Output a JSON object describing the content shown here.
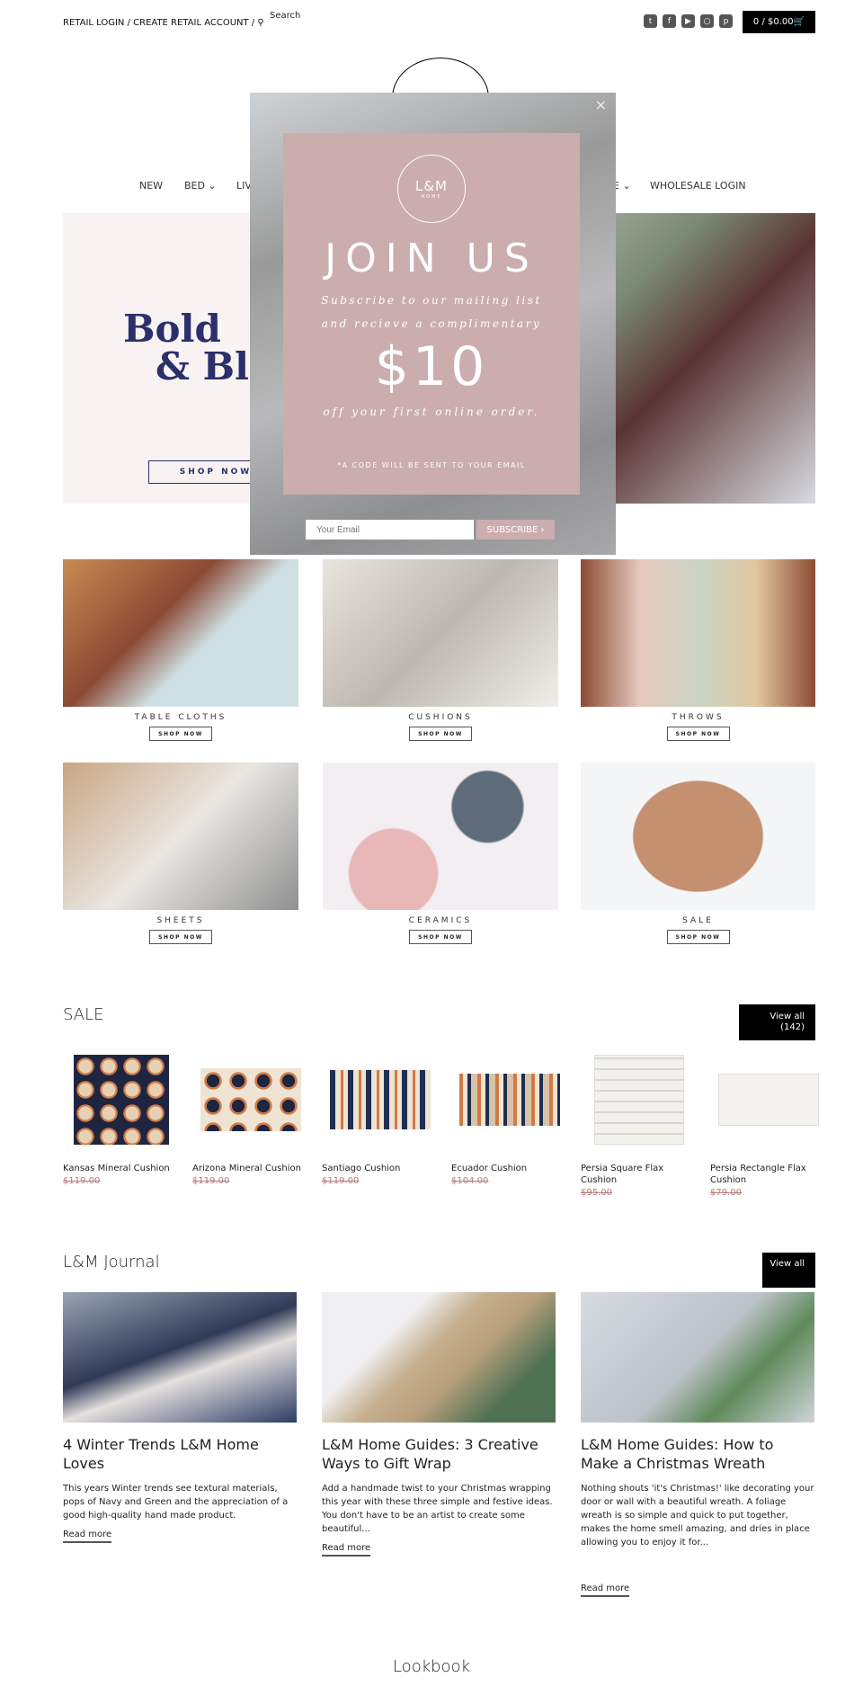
{
  "header": {
    "retail_login": "RETAIL LOGIN",
    "create_account": " / CREATE RETAIL ACCOUNT",
    "sep": " / ",
    "search": "Search",
    "cart": "0 / $0.00",
    "social": [
      "twitter-icon",
      "facebook-icon",
      "youtube-icon",
      "instagram-icon",
      "pinterest-icon"
    ]
  },
  "nav": {
    "items": [
      "NEW",
      "BED",
      "LIV",
      "E",
      "WHOLESALE LOGIN"
    ]
  },
  "hero": {
    "line1": "Bold",
    "line2": "& Bl",
    "button": "SHOP NOW",
    "color": "#2b2f6b"
  },
  "categories": [
    {
      "label": "TABLE CLOTHS",
      "button": "SHOP NOW"
    },
    {
      "label": "CUSHIONS",
      "button": "SHOP NOW"
    },
    {
      "label": "THROWS",
      "button": "SHOP NOW"
    },
    {
      "label": "SHEETS",
      "button": "SHOP NOW"
    },
    {
      "label": "CERAMICS",
      "button": "SHOP NOW"
    },
    {
      "label": "SALE",
      "button": "SHOP NOW"
    }
  ],
  "sale": {
    "title": "SALE",
    "view_all": "View all",
    "count": "(142)",
    "products": [
      {
        "name": "Kansas Mineral Cushion",
        "price": "$119.00"
      },
      {
        "name": "Arizona Mineral Cushion",
        "price": "$119.00"
      },
      {
        "name": "Santiago Cushion",
        "price": "$119.00"
      },
      {
        "name": "Ecuador Cushion",
        "price": "$104.00"
      },
      {
        "name": "Persia Square Flax Cushion",
        "price": "$95.00"
      },
      {
        "name": "Persia Rectangle Flax Cushion",
        "price": "$79.00"
      }
    ]
  },
  "journal": {
    "title": "L&M Journal",
    "view_all": "View all",
    "posts": [
      {
        "title": "4 Winter Trends L&M Home Loves",
        "body": "This years Winter trends see textural materials, pops of Navy and Green and the appreciation of a good high-quality hand made product.",
        "more": "Read more"
      },
      {
        "title": "L&M Home Guides: 3 Creative Ways to Gift Wrap",
        "body": "Add a handmade twist to your Christmas wrapping this year with these three simple and festive ideas. You don't have to be an artist to create some beautiful...",
        "more": "Read more"
      },
      {
        "title": "L&M Home Guides: How to Make a Christmas Wreath",
        "body": "Nothing shouts 'it's Christmas!' like decorating your door or wall with a beautiful wreath. A foliage wreath is so simple and quick to put together, makes the home smell amazing, and dries in place allowing you to enjoy it for...",
        "more": "Read more"
      }
    ]
  },
  "lookbook": "Lookbook",
  "popup": {
    "logo": "L&M",
    "logo_sub": "HOME",
    "title": "JOIN US",
    "line1": "Subscribe to our mailing list",
    "line2": "and recieve a complimentary",
    "amount": "$10",
    "line3": "off your first online order.",
    "note": "*A CODE WILL BE SENT TO YOUR EMAIL",
    "email_placeholder": "Your Email",
    "subscribe": "SUBSCRIBE  ›",
    "close": "×",
    "pink": "#cbadae"
  }
}
